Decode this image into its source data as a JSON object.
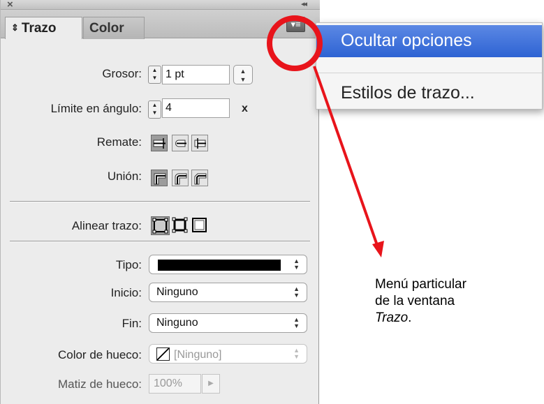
{
  "panel": {
    "close_glyph": "×",
    "collapse_glyph": "◂◂",
    "tabs": [
      {
        "label": "Trazo",
        "arrows": "⇕",
        "active": true
      },
      {
        "label": "Color",
        "active": false
      }
    ],
    "menu_button_glyph": "▾≡"
  },
  "fields": {
    "weight": {
      "label": "Grosor:",
      "value": "1 pt"
    },
    "miter": {
      "label": "Límite en ángulo:",
      "value": "4",
      "unit": "x"
    },
    "cap": {
      "label": "Remate:",
      "options": [
        "butt-cap-icon",
        "round-cap-icon",
        "projecting-cap-icon"
      ],
      "selected": 0
    },
    "join": {
      "label": "Unión:",
      "options": [
        "miter-join-icon",
        "round-join-icon",
        "bevel-join-icon"
      ],
      "selected": 0
    },
    "align": {
      "label": "Alinear trazo:",
      "options": [
        "align-center-icon",
        "align-inside-icon",
        "align-outside-icon"
      ],
      "selected": 0
    },
    "type": {
      "label": "Tipo:",
      "value": "solid-line"
    },
    "start": {
      "label": "Inicio:",
      "value": "Ninguno"
    },
    "end": {
      "label": "Fin:",
      "value": "Ninguno"
    },
    "gap_color": {
      "label": "Color de hueco:",
      "value": "[Ninguno]"
    },
    "gap_tint": {
      "label": "Matiz de hueco:",
      "value": "100%"
    }
  },
  "popup_menu": {
    "items": [
      {
        "label": "Ocultar opciones",
        "highlighted": true
      },
      {
        "label": "Estilos de trazo...",
        "highlighted": false
      }
    ]
  },
  "annotation": {
    "caption_line1": "Menú particular",
    "caption_line2": "de la ventana",
    "caption_italic": "Trazo",
    "caption_end": ".",
    "color": "#e8141b"
  }
}
